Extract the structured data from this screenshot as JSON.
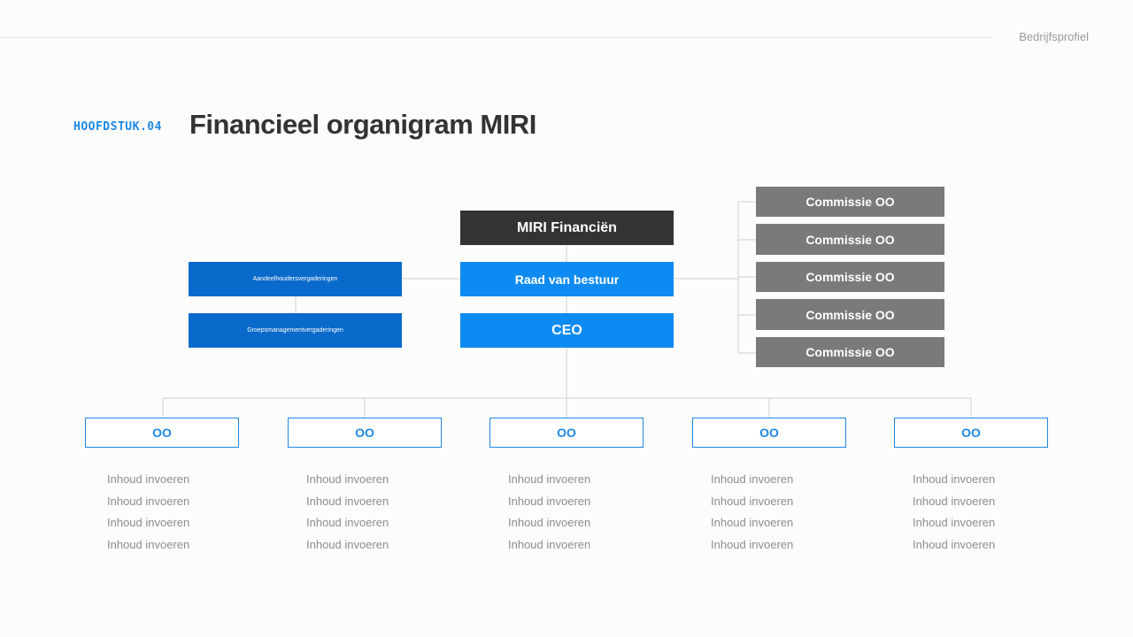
{
  "header": {
    "section_label": "Bedrijfsprofiel",
    "chapter": "HOOFDSTUK.04",
    "title": "Financieel organigram MIRI"
  },
  "org": {
    "root": "MIRI Financiën",
    "board": "Raad van bestuur",
    "ceo": "CEO",
    "left_boxes": [
      "Aandeelhoudersvergaderingen",
      "Groepsmanagementvergaderingen"
    ],
    "committees": [
      "Commissie OO",
      "Commissie OO",
      "Commissie OO",
      "Commissie OO",
      "Commissie OO"
    ],
    "departments": [
      {
        "label": "OO",
        "items": [
          "Inhoud invoeren",
          "Inhoud invoeren",
          "Inhoud invoeren",
          "Inhoud invoeren"
        ]
      },
      {
        "label": "OO",
        "items": [
          "Inhoud invoeren",
          "Inhoud invoeren",
          "Inhoud invoeren",
          "Inhoud invoeren"
        ]
      },
      {
        "label": "OO",
        "items": [
          "Inhoud invoeren",
          "Inhoud invoeren",
          "Inhoud invoeren",
          "Inhoud invoeren"
        ]
      },
      {
        "label": "OO",
        "items": [
          "Inhoud invoeren",
          "Inhoud invoeren",
          "Inhoud invoeren",
          "Inhoud invoeren"
        ]
      },
      {
        "label": "OO",
        "items": [
          "Inhoud invoeren",
          "Inhoud invoeren",
          "Inhoud invoeren",
          "Inhoud invoeren"
        ]
      }
    ]
  },
  "colors": {
    "dark": "#333333",
    "blue": "#0d8bf2",
    "navy": "#0a6acb",
    "gray": "#7a7a7a",
    "accent": "#1e88e5",
    "line": "#cfcfcf"
  }
}
